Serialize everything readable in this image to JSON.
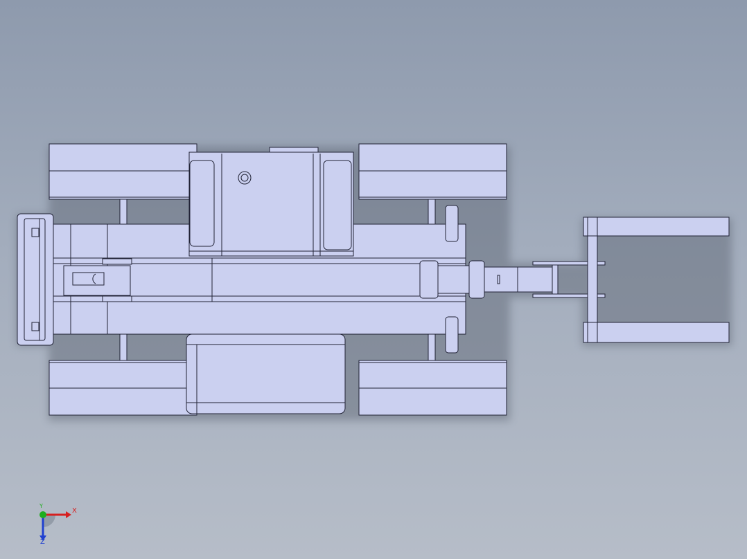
{
  "viewport": {
    "background_top": "#8e9aad",
    "background_bottom": "#b6bdc8"
  },
  "model": {
    "fill_color": "#cbd0f0",
    "edge_color": "#202235",
    "shadow_color": "#5a6270"
  },
  "triad": {
    "x_label": "X",
    "y_label": "Y",
    "z_label": "Z",
    "x_color": "#d62020",
    "y_color": "#1fae1f",
    "z_color": "#2040d0"
  }
}
